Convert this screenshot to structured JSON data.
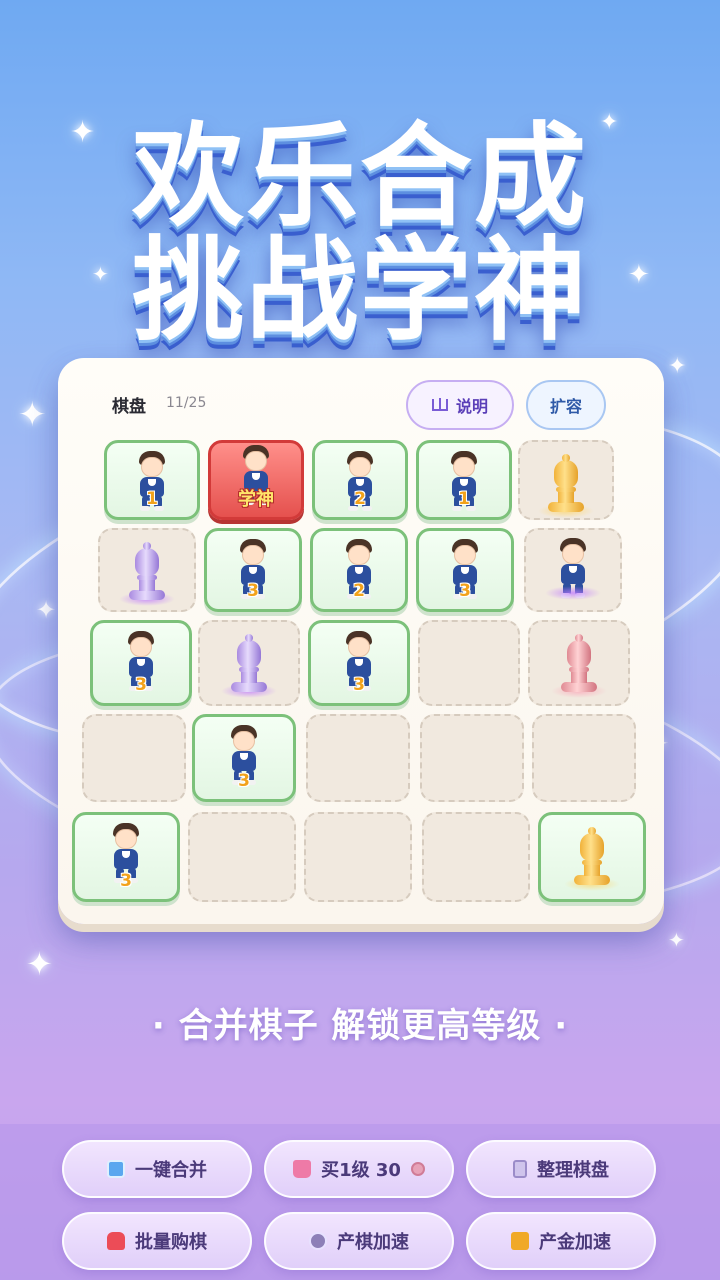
{
  "title": {
    "line1": "欢乐合成",
    "line2": "挑战学神"
  },
  "board": {
    "label": "棋盘",
    "count": "11/25",
    "help_button": "说明",
    "expand_button": "扩容",
    "cells": [
      {
        "type": "kid",
        "level": "1"
      },
      {
        "type": "god",
        "level": "学神"
      },
      {
        "type": "kid",
        "level": "2"
      },
      {
        "type": "kid",
        "level": "1"
      },
      {
        "type": "bishop",
        "color": "gold"
      },
      {
        "type": "bishop",
        "color": "purple"
      },
      {
        "type": "kid",
        "level": "3"
      },
      {
        "type": "kid",
        "level": "2"
      },
      {
        "type": "kid",
        "level": "3"
      },
      {
        "type": "kid-glow",
        "level": ""
      },
      {
        "type": "kid",
        "level": "3"
      },
      {
        "type": "bishop",
        "color": "purple"
      },
      {
        "type": "kid",
        "level": "3"
      },
      {
        "type": "empty"
      },
      {
        "type": "bishop",
        "color": "pink"
      },
      {
        "type": "empty"
      },
      {
        "type": "kid",
        "level": "3"
      },
      {
        "type": "empty"
      },
      {
        "type": "empty"
      },
      {
        "type": "empty"
      },
      {
        "type": "kid",
        "level": "3"
      },
      {
        "type": "empty"
      },
      {
        "type": "empty"
      },
      {
        "type": "empty"
      },
      {
        "type": "bishop-tile",
        "color": "gold"
      }
    ]
  },
  "tagline": "· 合并棋子 解锁更高等级 ·",
  "actions": {
    "merge_all": "一键合并",
    "buy_level1": "买1级 30",
    "tidy_board": "整理棋盘",
    "bulk_buy": "批量购棋",
    "speed_production": "产棋加速",
    "speed_gold": "产金加速"
  },
  "colors": {
    "tile_border": "#7cc17a",
    "god_tile": "#e5514e",
    "level_text": "#f2a21b",
    "title_shadow": "#3a5fcf"
  }
}
